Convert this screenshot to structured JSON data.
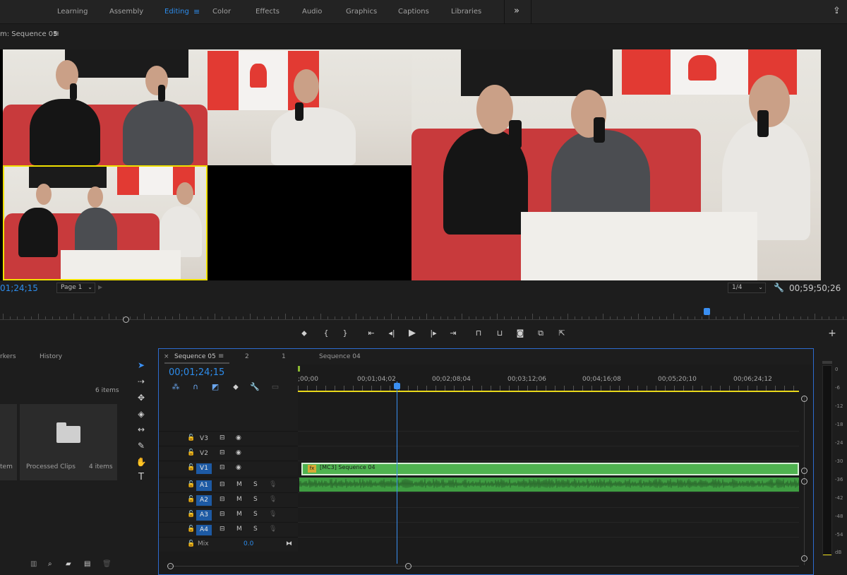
{
  "workspaces": [
    "Learning",
    "Assembly",
    "Editing",
    "Color",
    "Effects",
    "Audio",
    "Graphics",
    "Captions",
    "Libraries"
  ],
  "active_workspace": "Editing",
  "overflow_label": "»",
  "program_monitor": {
    "title": "m: Sequence 05",
    "menu_icon": "hamburger-menu-icon",
    "timecode_current": "01;24;15",
    "page_label": "Page 1",
    "zoom_label": "1/4",
    "timecode_duration": "00;59;50;26"
  },
  "transport_buttons": [
    "marker",
    "mark-in",
    "mark-out",
    "go-to-in",
    "step-back",
    "play",
    "step-forward",
    "go-to-out",
    "lift",
    "extract",
    "export-frame",
    "comparison-view",
    "export"
  ],
  "project_panel": {
    "tab_markers": "rkers",
    "tab_history": "History",
    "item_count": "6 items",
    "folder_name": "Processed Clips",
    "folder_count": "4 items",
    "partial_label": "tem"
  },
  "timeline": {
    "tabs": {
      "close": "×",
      "active": "Sequence 05",
      "menu": "≡",
      "tab2": "2",
      "tab3": "1",
      "tab4": "Sequence 04"
    },
    "timecode": "00;01;24;15",
    "ruler_labels": [
      ";00;00",
      "00;01;04;02",
      "00;02;08;04",
      "00;03;12;06",
      "00;04;16;08",
      "00;05;20;10",
      "00;06;24;12"
    ],
    "video_tracks": [
      "V3",
      "V2",
      "V1"
    ],
    "audio_tracks": [
      "A1",
      "A2",
      "A3",
      "A4"
    ],
    "active_video": "V1",
    "active_audio": "A1",
    "mute_label": "M",
    "solo_label": "S",
    "mix_label": "Mix",
    "mix_value": "0.0",
    "clip_v1_name": "[MC3] Sequence 04",
    "clip_v1_fx": "fx"
  },
  "meters": {
    "db_labels": [
      "0",
      "-6",
      "-12",
      "-18",
      "-24",
      "-30",
      "-36",
      "-42",
      "-48",
      "-54",
      "dB"
    ]
  },
  "colors": {
    "accent": "#2d8ceb",
    "clip_green": "#4fb350",
    "audio_green": "#3f9d42",
    "playhead": "#3a8ff2",
    "work_area": "#e8d81a",
    "couch": "#c83a3c",
    "flag": "#e23a33"
  }
}
